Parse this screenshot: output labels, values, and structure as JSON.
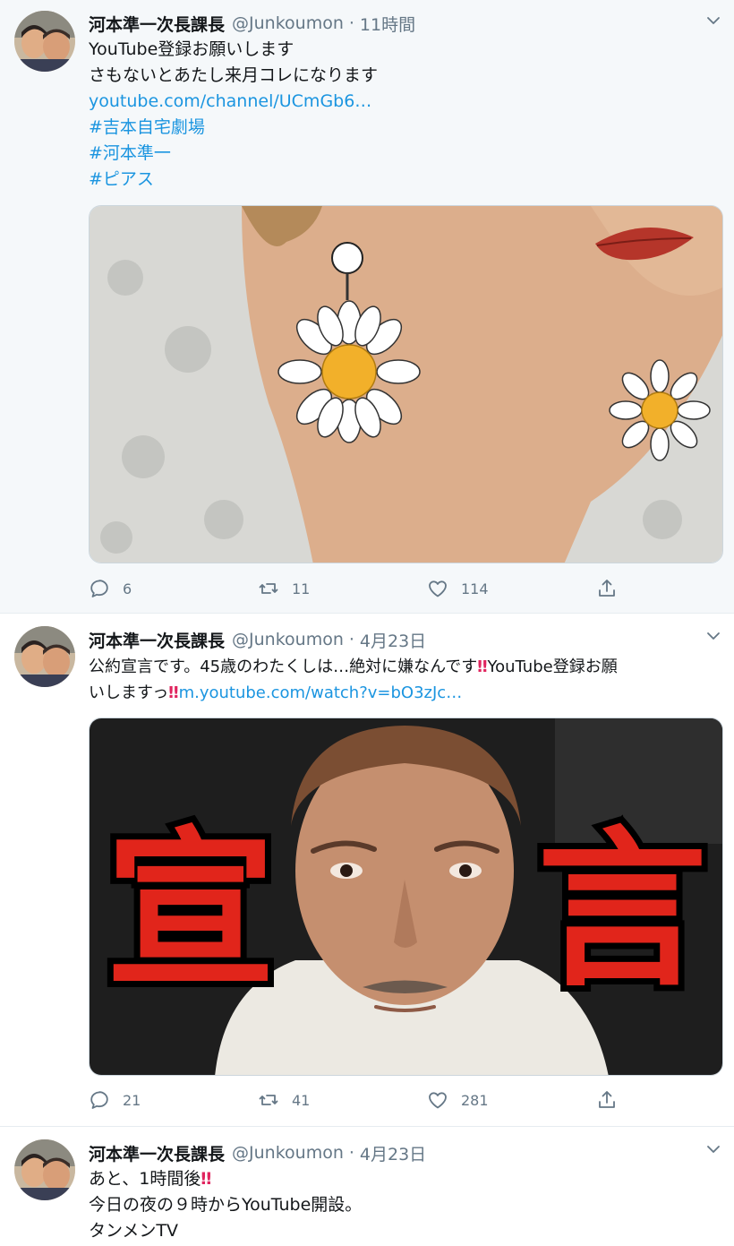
{
  "tweets": [
    {
      "author": "河本準一次長課長",
      "handle": "@Junkoumon",
      "separator": "·",
      "time": "11時間",
      "lines": [
        {
          "text": "YouTube登録お願いします",
          "kind": "text"
        },
        {
          "text": "さもないとあたし来月コレになります",
          "kind": "text"
        },
        {
          "text": "youtube.com/channel/UCmGb6…",
          "kind": "link"
        },
        {
          "text": "#吉本自宅劇場",
          "kind": "link"
        },
        {
          "text": "#河本準一",
          "kind": "link"
        },
        {
          "text": "#ピアス",
          "kind": "link"
        }
      ],
      "media_subject": "daisy-earring-photo",
      "stats": {
        "replies": "6",
        "retweets": "11",
        "likes": "114"
      }
    },
    {
      "author": "河本準一次長課長",
      "handle": "@Junkoumon",
      "separator": "·",
      "time": "4月23日",
      "line1_text": "公約宣言です。45歳のわたくしは…絶対に嫌なんです",
      "line1_bang": "‼",
      "line1_tail": "YouTube登録お願",
      "line2_text": "いしますっ",
      "line2_bang": "‼",
      "line2_link": "m.youtube.com/watch?v=bO3zJc…",
      "media_subject": "man-selfie-thumbnail",
      "media_overlay_left": "宣",
      "media_overlay_right": "言",
      "stats": {
        "replies": "21",
        "retweets": "41",
        "likes": "281"
      }
    },
    {
      "author": "河本準一次長課長",
      "handle": "@Junkoumon",
      "separator": "·",
      "time": "4月23日",
      "line1_text": "あと、1時間後",
      "line1_bang": "‼",
      "line2_text": "今日の夜の９時からYouTube開設。",
      "line3_text": "タンメンTV"
    }
  ],
  "colors": {
    "link": "#1b95e0",
    "muted": "#657786",
    "bang": "#e0245e",
    "overlay_red": "#e1251b"
  },
  "icons": [
    "reply-icon",
    "retweet-icon",
    "like-icon",
    "share-icon",
    "caret-down-icon"
  ]
}
